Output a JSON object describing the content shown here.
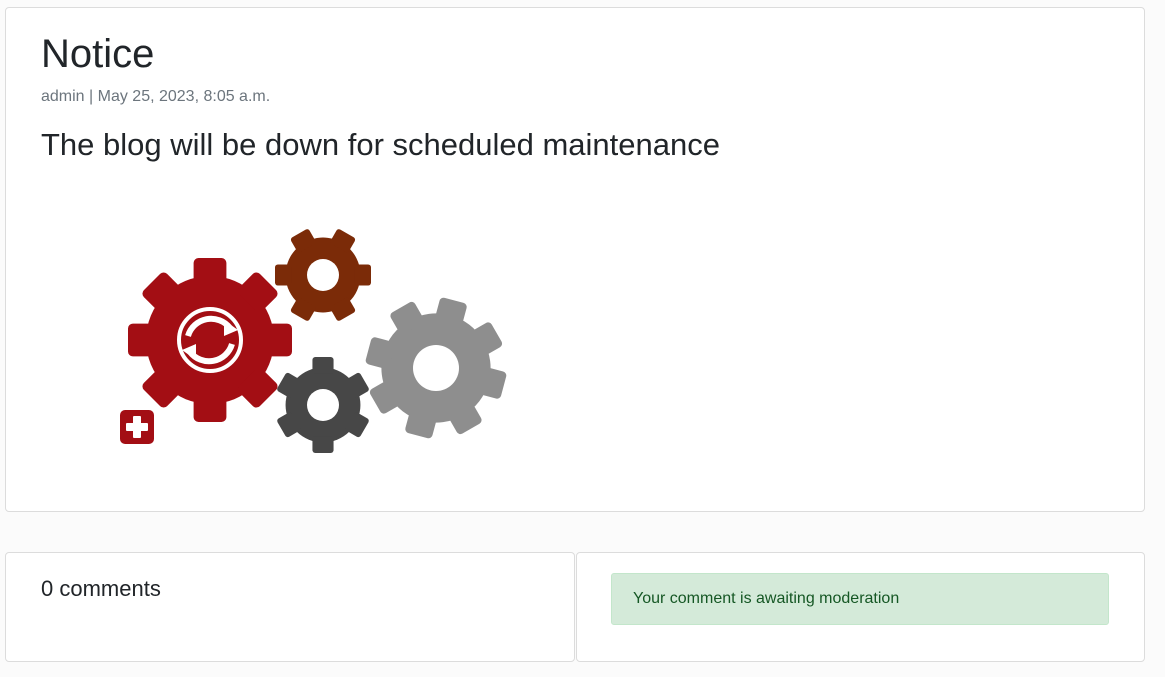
{
  "post": {
    "title": "Notice",
    "meta": "admin | May 25, 2023, 8:05 a.m.",
    "body": "The blog will be down for scheduled maintenance",
    "image": {
      "icons": [
        "large-red-gear-with-sync-icon",
        "brown-gear-icon",
        "dark-gray-gear-icon",
        "light-gray-gear-icon",
        "red-plus-icon"
      ],
      "colors": {
        "red": "#a30e14",
        "brown": "#7b2b08",
        "dark_gray": "#474747",
        "light_gray": "#8e8e8e"
      }
    }
  },
  "comments": {
    "count_label": "0 comments"
  },
  "moderation_alert": {
    "text": "Your comment is awaiting moderation",
    "background": "#d4ead9",
    "text_color": "#155724"
  }
}
